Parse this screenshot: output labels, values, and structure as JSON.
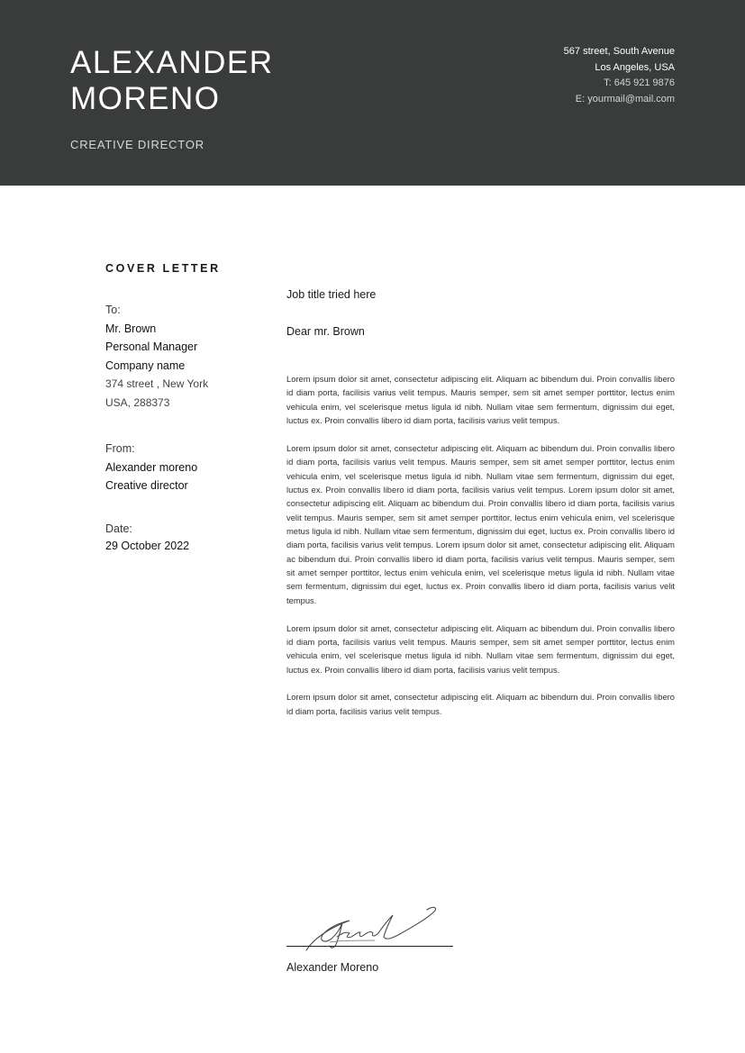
{
  "header": {
    "name_line1": "ALEXANDER",
    "name_line2": "MORENO",
    "role": "CREATIVE  DIRECTOR",
    "contact": {
      "street": "567 street, South Avenue",
      "city": "Los Angeles, USA",
      "phone": "T: 645 921 9876",
      "email": "E: yourmail@mail.com"
    }
  },
  "section_title": "COVER LETTER",
  "recipient": {
    "label": "To:",
    "name": "Mr. Brown",
    "position": "Personal Manager",
    "company": "Company name",
    "address_line1": "374 street  , New York",
    "address_line2": "USA, 288373"
  },
  "sender": {
    "label": "From:",
    "name": "Alexander moreno",
    "position": "Creative  director"
  },
  "date": {
    "label": "Date:",
    "value": "29 October 2022"
  },
  "letter": {
    "job_title": "Job title tried here",
    "salutation": "Dear mr. Brown",
    "paragraphs": [
      "Lorem ipsum dolor sit amet, consectetur adipiscing elit. Aliquam ac bibendum dui. Proin convallis libero id diam porta, facilisis varius velit tempus. Mauris semper, sem sit amet semper porttitor, lectus enim vehicula enim, vel scelerisque metus ligula id nibh. Nullam vitae sem fermentum, dignissim dui eget, luctus ex. Proin convallis libero id diam porta, facilisis varius velit tempus.",
      "Lorem ipsum dolor sit amet, consectetur adipiscing elit. Aliquam ac bibendum dui. Proin convallis libero id diam porta, facilisis varius velit tempus. Mauris semper, sem sit amet semper porttitor, lectus enim vehicula enim, vel scelerisque metus ligula id nibh. Nullam vitae sem fermentum, dignissim dui eget, luctus ex. Proin convallis libero id diam porta, facilisis varius velit tempus. Lorem ipsum dolor sit amet, consectetur adipiscing elit. Aliquam ac bibendum dui. Proin convallis libero id diam porta, facilisis varius velit tempus. Mauris semper, sem sit amet semper porttitor, lectus enim vehicula enim, vel scelerisque metus ligula id nibh. Nullam vitae sem fermentum, dignissim dui eget, luctus ex. Proin convallis libero id diam porta, facilisis varius velit tempus. Lorem ipsum dolor sit amet, consectetur adipiscing elit. Aliquam ac bibendum dui. Proin convallis libero id diam porta, facilisis varius velit tempus. Mauris semper, sem sit amet semper porttitor, lectus enim vehicula enim, vel scelerisque metus ligula id nibh. Nullam vitae sem fermentum, dignissim dui eget, luctus ex. Proin convallis libero id diam porta, facilisis varius velit tempus.",
      "Lorem ipsum dolor sit amet, consectetur adipiscing elit. Aliquam ac bibendum dui. Proin convallis libero id diam porta, facilisis varius velit tempus. Mauris semper, sem sit amet semper porttitor, lectus enim vehicula enim, vel scelerisque metus ligula id nibh. Nullam vitae sem fermentum, dignissim dui eget, luctus ex. Proin convallis libero id diam porta, facilisis varius velit tempus.",
      "Lorem ipsum dolor sit amet, consectetur adipiscing elit. Aliquam ac bibendum dui. Proin convallis libero id diam porta, facilisis varius velit tempus."
    ]
  },
  "signature": {
    "name": "Alexander Moreno"
  },
  "colors": {
    "header_background": "#3a3c3c",
    "header_text": "#ffffff"
  }
}
